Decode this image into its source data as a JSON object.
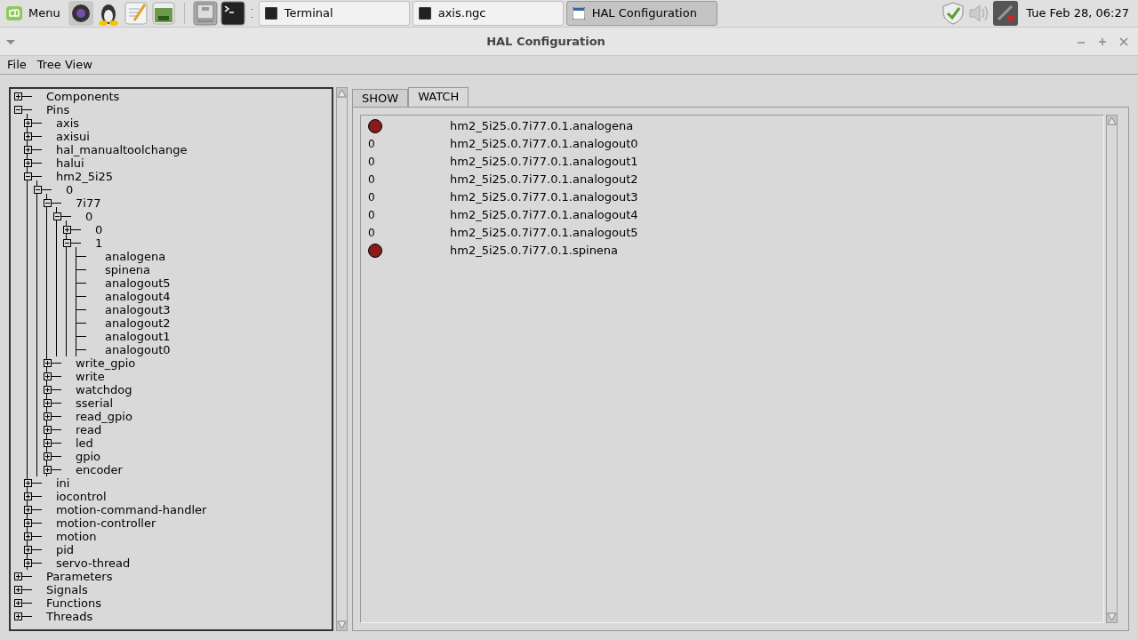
{
  "taskbar": {
    "menu_label": "Menu",
    "windows": [
      {
        "title": "Terminal",
        "selected": false
      },
      {
        "title": "axis.ngc",
        "selected": false
      },
      {
        "title": "HAL Configuration",
        "selected": true
      }
    ],
    "clock": "Tue Feb 28, 06:27"
  },
  "window": {
    "title": "HAL Configuration"
  },
  "menu": [
    "File",
    "Tree View"
  ],
  "tree": [
    {
      "label": "Components",
      "expanded": false
    },
    {
      "label": "Pins",
      "expanded": true,
      "children": [
        {
          "label": "axis",
          "expanded": false
        },
        {
          "label": "axisui",
          "expanded": false
        },
        {
          "label": "hal_manualtoolchange",
          "expanded": false
        },
        {
          "label": "halui",
          "expanded": false
        },
        {
          "label": "hm2_5i25",
          "expanded": true,
          "children": [
            {
              "label": "0",
              "expanded": true,
              "children": [
                {
                  "label": "7i77",
                  "expanded": true,
                  "children": [
                    {
                      "label": "0",
                      "expanded": true,
                      "children": [
                        {
                          "label": "0",
                          "expanded": false
                        },
                        {
                          "label": "1",
                          "expanded": true,
                          "children": [
                            {
                              "label": "analogena"
                            },
                            {
                              "label": "spinena"
                            },
                            {
                              "label": "analogout5"
                            },
                            {
                              "label": "analogout4"
                            },
                            {
                              "label": "analogout3"
                            },
                            {
                              "label": "analogout2"
                            },
                            {
                              "label": "analogout1"
                            },
                            {
                              "label": "analogout0"
                            }
                          ]
                        }
                      ]
                    }
                  ]
                },
                {
                  "label": "write_gpio",
                  "expanded": false
                },
                {
                  "label": "write",
                  "expanded": false
                },
                {
                  "label": "watchdog",
                  "expanded": false
                },
                {
                  "label": "sserial",
                  "expanded": false
                },
                {
                  "label": "read_gpio",
                  "expanded": false
                },
                {
                  "label": "read",
                  "expanded": false
                },
                {
                  "label": "led",
                  "expanded": false
                },
                {
                  "label": "gpio",
                  "expanded": false
                },
                {
                  "label": "encoder",
                  "expanded": false
                }
              ]
            }
          ]
        },
        {
          "label": "ini",
          "expanded": false
        },
        {
          "label": "iocontrol",
          "expanded": false
        },
        {
          "label": "motion-command-handler",
          "expanded": false
        },
        {
          "label": "motion-controller",
          "expanded": false
        },
        {
          "label": "motion",
          "expanded": false
        },
        {
          "label": "pid",
          "expanded": false
        },
        {
          "label": "servo-thread",
          "expanded": false
        }
      ]
    },
    {
      "label": "Parameters",
      "expanded": false
    },
    {
      "label": "Signals",
      "expanded": false
    },
    {
      "label": "Functions",
      "expanded": false
    },
    {
      "label": "Threads",
      "expanded": false
    }
  ],
  "tabs": [
    {
      "label": "SHOW",
      "selected": false
    },
    {
      "label": "WATCH",
      "selected": true
    }
  ],
  "watch": [
    {
      "kind": "bit",
      "on": false,
      "name": "hm2_5i25.0.7i77.0.1.analogena"
    },
    {
      "kind": "number",
      "value": "0",
      "name": "hm2_5i25.0.7i77.0.1.analogout0"
    },
    {
      "kind": "number",
      "value": "0",
      "name": "hm2_5i25.0.7i77.0.1.analogout1"
    },
    {
      "kind": "number",
      "value": "0",
      "name": "hm2_5i25.0.7i77.0.1.analogout2"
    },
    {
      "kind": "number",
      "value": "0",
      "name": "hm2_5i25.0.7i77.0.1.analogout3"
    },
    {
      "kind": "number",
      "value": "0",
      "name": "hm2_5i25.0.7i77.0.1.analogout4"
    },
    {
      "kind": "number",
      "value": "0",
      "name": "hm2_5i25.0.7i77.0.1.analogout5"
    },
    {
      "kind": "bit",
      "on": false,
      "name": "hm2_5i25.0.7i77.0.1.spinena"
    }
  ]
}
